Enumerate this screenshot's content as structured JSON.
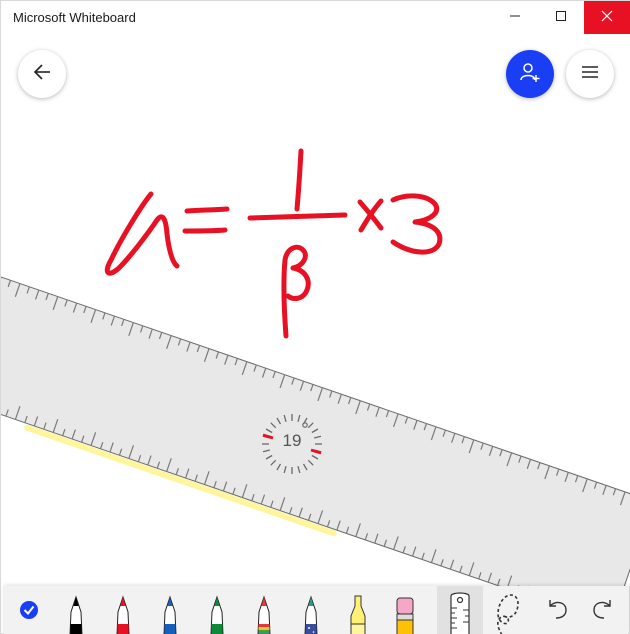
{
  "window": {
    "title": "Microsoft Whiteboard"
  },
  "canvas": {
    "ruler_angle": "19",
    "ink_color": "#e81123",
    "highlighter_color": "#fff59d"
  },
  "header_actions": {
    "back": "arrow-left-icon",
    "invite": "person-add-icon",
    "menu": "hamburger-icon",
    "invite_color": "#1a3ef3"
  },
  "toolbar": {
    "tools": [
      {
        "name": "checkmark",
        "icon": "checkmark-icon",
        "color": "#1a3ef3"
      },
      {
        "name": "pen-black",
        "icon": "pen-icon",
        "color": "#000000"
      },
      {
        "name": "pen-red",
        "icon": "pen-icon",
        "color": "#e81123"
      },
      {
        "name": "pen-blue",
        "icon": "pen-icon",
        "color": "#1560bd"
      },
      {
        "name": "pen-green",
        "icon": "pen-icon",
        "color": "#0f8a3a"
      },
      {
        "name": "pen-rainbow",
        "icon": "pen-icon",
        "color": "#ff6f3c"
      },
      {
        "name": "pen-galaxy",
        "icon": "pen-icon",
        "color": "#1d5fa8"
      },
      {
        "name": "highlighter",
        "icon": "highlighter-icon",
        "color": "#fff176"
      },
      {
        "name": "eraser",
        "icon": "eraser-icon",
        "color": "#f4a7c6"
      },
      {
        "name": "ruler",
        "icon": "ruler-icon",
        "selected": true
      },
      {
        "name": "lasso",
        "icon": "lasso-icon"
      },
      {
        "name": "undo",
        "icon": "undo-icon"
      },
      {
        "name": "redo",
        "icon": "redo-icon"
      }
    ]
  }
}
